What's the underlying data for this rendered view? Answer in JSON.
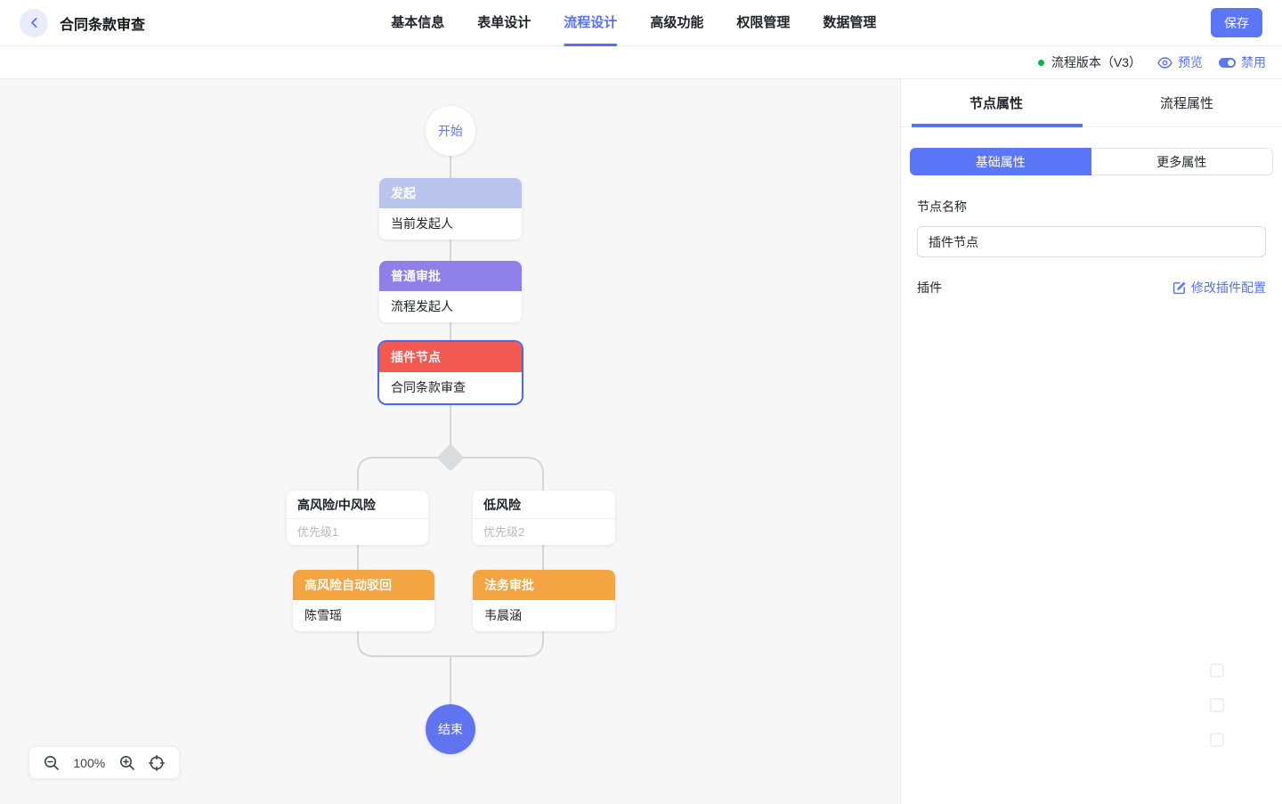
{
  "header": {
    "title": "合同条款审查",
    "nav": [
      {
        "label": "基本信息",
        "active": false
      },
      {
        "label": "表单设计",
        "active": false
      },
      {
        "label": "流程设计",
        "active": true
      },
      {
        "label": "高级功能",
        "active": false
      },
      {
        "label": "权限管理",
        "active": false
      },
      {
        "label": "数据管理",
        "active": false
      }
    ],
    "save_label": "保存"
  },
  "toolbar": {
    "version_label": "流程版本（V3）",
    "preview_label": "预览",
    "disable_label": "禁用"
  },
  "canvas": {
    "zoom_level": "100%",
    "flow": {
      "start_label": "开始",
      "end_label": "结束",
      "nodes": [
        {
          "title": "发起",
          "subtitle": "当前发起人",
          "color": "#bac4ed",
          "selected": false
        },
        {
          "title": "普通审批",
          "subtitle": "流程发起人",
          "color": "#8e80e8",
          "selected": false
        },
        {
          "title": "插件节点",
          "subtitle": "合同条款审查",
          "color": "#f25a51",
          "selected": true
        }
      ],
      "branches": [
        {
          "condition": "高风险/中风险",
          "priority": "优先级1",
          "node_title": "高风险自动驳回",
          "node_subtitle": "陈雪瑶"
        },
        {
          "condition": "低风险",
          "priority": "优先级2",
          "node_title": "法务审批",
          "node_subtitle": "韦晨涵"
        }
      ],
      "branch_color": "#f4a542"
    }
  },
  "panel": {
    "tabs": [
      {
        "label": "节点属性",
        "active": true
      },
      {
        "label": "流程属性",
        "active": false
      }
    ],
    "sub_tabs": [
      {
        "label": "基础属性",
        "active": true
      },
      {
        "label": "更多属性",
        "active": false
      }
    ],
    "fields": {
      "node_name_label": "节点名称",
      "node_name_value": "插件节点",
      "plugin_label": "插件",
      "plugin_action": "修改插件配置"
    }
  },
  "colors": {
    "accent": "#5571f5",
    "save_button": "#5b76f7",
    "node_initiate": "#bac4ed",
    "node_approval": "#8e80e8",
    "node_plugin": "#f25a51",
    "node_branch": "#f4a542",
    "end_circle": "#5f74ee",
    "selected_border": "#4d68f0",
    "status_green": "#00b846",
    "connector": "#d6d6d9",
    "canvas_bg": "#f7f7f8"
  }
}
